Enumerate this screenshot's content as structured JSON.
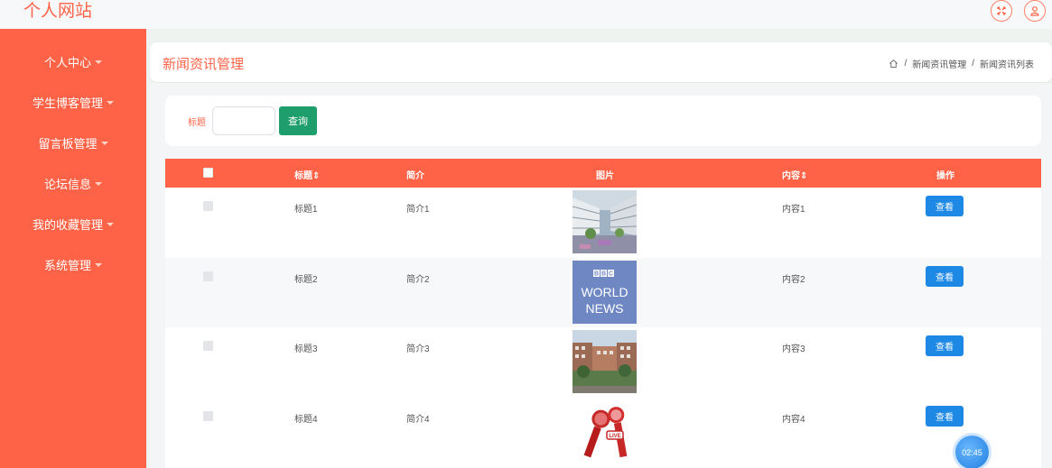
{
  "site": {
    "title": "个人网站"
  },
  "sidebar": {
    "items": [
      {
        "label": "个人中心"
      },
      {
        "label": "学生博客管理"
      },
      {
        "label": "留言板管理"
      },
      {
        "label": "论坛信息"
      },
      {
        "label": "我的收藏管理"
      },
      {
        "label": "系统管理"
      }
    ]
  },
  "header": {
    "title": "新闻资讯管理",
    "breadcrumb": [
      "新闻资讯管理",
      "新闻资讯列表"
    ],
    "separator": "/"
  },
  "search": {
    "label": "标题",
    "value": "",
    "placeholder": "",
    "button_label": "查询"
  },
  "table": {
    "headers": {
      "title": "标题",
      "intro": "简介",
      "image": "图片",
      "content": "内容",
      "actions": "操作"
    },
    "rows": [
      {
        "title": "标题1",
        "intro": "简介1",
        "image": "campus-courtyard",
        "content": "内容1",
        "action": "查看"
      },
      {
        "title": "标题2",
        "intro": "简介2",
        "image": "bbc-world-news",
        "content": "内容2",
        "action": "查看"
      },
      {
        "title": "标题3",
        "intro": "简介3",
        "image": "campus-building",
        "content": "内容3",
        "action": "查看"
      },
      {
        "title": "标题4",
        "intro": "简介4",
        "image": "live-microphones",
        "content": "内容4",
        "action": "查看"
      }
    ]
  },
  "thumb_text": {
    "bbc_logo": "BBC",
    "bbc_line1": "WORLD",
    "bbc_line2": "NEWS",
    "mic_badge": "LIVE"
  },
  "clock": {
    "time": "02:45"
  },
  "colors": {
    "accent": "#ff6347",
    "search_button": "#1e9e6a",
    "view_button": "#1e88e5"
  }
}
